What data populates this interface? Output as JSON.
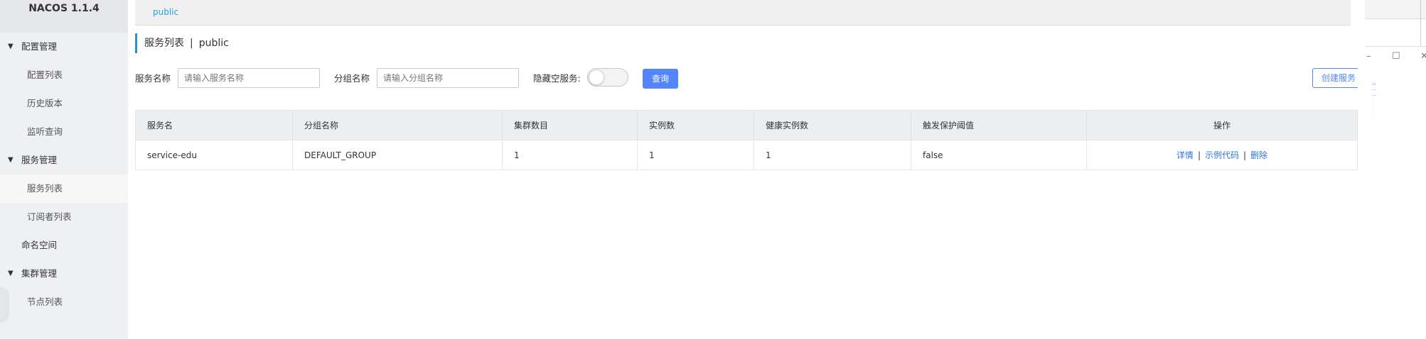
{
  "app": {
    "title": "NACOS 1.1.4"
  },
  "sidebar": {
    "items": [
      {
        "label": "配置管理",
        "type": "group"
      },
      {
        "label": "配置列表",
        "type": "sub"
      },
      {
        "label": "历史版本",
        "type": "sub"
      },
      {
        "label": "监听查询",
        "type": "sub"
      },
      {
        "label": "服务管理",
        "type": "group"
      },
      {
        "label": "服务列表",
        "type": "sub",
        "active": true
      },
      {
        "label": "订阅者列表",
        "type": "sub"
      },
      {
        "label": "命名空间",
        "type": "top"
      },
      {
        "label": "集群管理",
        "type": "group"
      },
      {
        "label": "节点列表",
        "type": "sub"
      }
    ]
  },
  "namespace": {
    "current": "public"
  },
  "page": {
    "title": "服务列表",
    "separator": "|",
    "namespace": "public"
  },
  "filter": {
    "service_name_label": "服务名称",
    "service_name_placeholder": "请输入服务名称",
    "group_name_label": "分组名称",
    "group_name_placeholder": "请输入分组名称",
    "hide_empty_label": "隐藏空服务:",
    "hide_empty_on": false,
    "query_button": "查询",
    "create_button": "创建服务"
  },
  "table": {
    "columns": [
      "服务名",
      "分组名称",
      "集群数目",
      "实例数",
      "健康实例数",
      "触发保护阈值",
      "操作"
    ],
    "rows": [
      {
        "service": "service-edu",
        "group": "DEFAULT_GROUP",
        "clusters": "1",
        "instances": "1",
        "healthy": "1",
        "threshold": "false",
        "actions": [
          "详情",
          "示例代码",
          "删除"
        ]
      }
    ]
  },
  "colors": {
    "primary": "#5584ff",
    "link": "#2f74d8",
    "accent": "#2b8fd8",
    "namespace_link": "#21a4dd"
  }
}
